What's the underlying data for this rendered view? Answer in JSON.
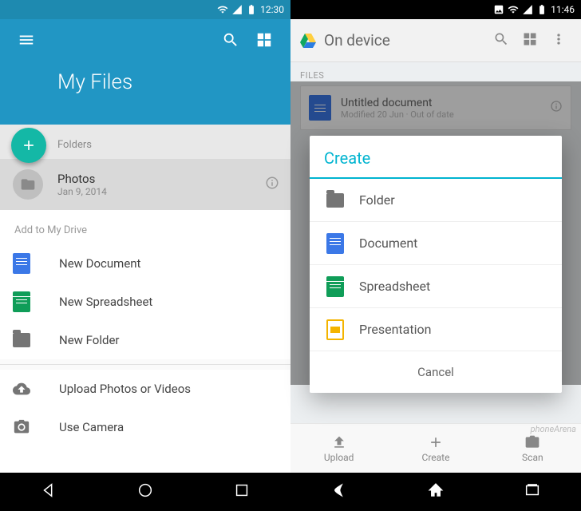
{
  "left": {
    "status": {
      "time": "12:30"
    },
    "title": "My Files",
    "section_folders_label": "Folders",
    "folder": {
      "name": "Photos",
      "date": "Jan 9, 2014"
    },
    "add_label": "Add to My Drive",
    "items": [
      {
        "label": "New Document",
        "kind": "doc"
      },
      {
        "label": "New Spreadsheet",
        "kind": "sheet"
      },
      {
        "label": "New Folder",
        "kind": "folder"
      }
    ],
    "more": [
      {
        "label": "Upload Photos or Videos",
        "kind": "cloud"
      },
      {
        "label": "Use Camera",
        "kind": "camera"
      }
    ]
  },
  "right": {
    "status": {
      "time": "11:46"
    },
    "title": "On device",
    "files_label": "FILES",
    "doc": {
      "title": "Untitled document",
      "subtitle": "Modified 20 Jun · Out of date"
    },
    "dialog": {
      "title": "Create",
      "options": [
        {
          "label": "Folder",
          "kind": "folder"
        },
        {
          "label": "Document",
          "kind": "doc"
        },
        {
          "label": "Spreadsheet",
          "kind": "sheet"
        },
        {
          "label": "Presentation",
          "kind": "slides"
        }
      ],
      "cancel": "Cancel"
    },
    "tabs": {
      "upload": "Upload",
      "create": "Create",
      "scan": "Scan"
    },
    "watermark": "phoneArena"
  }
}
